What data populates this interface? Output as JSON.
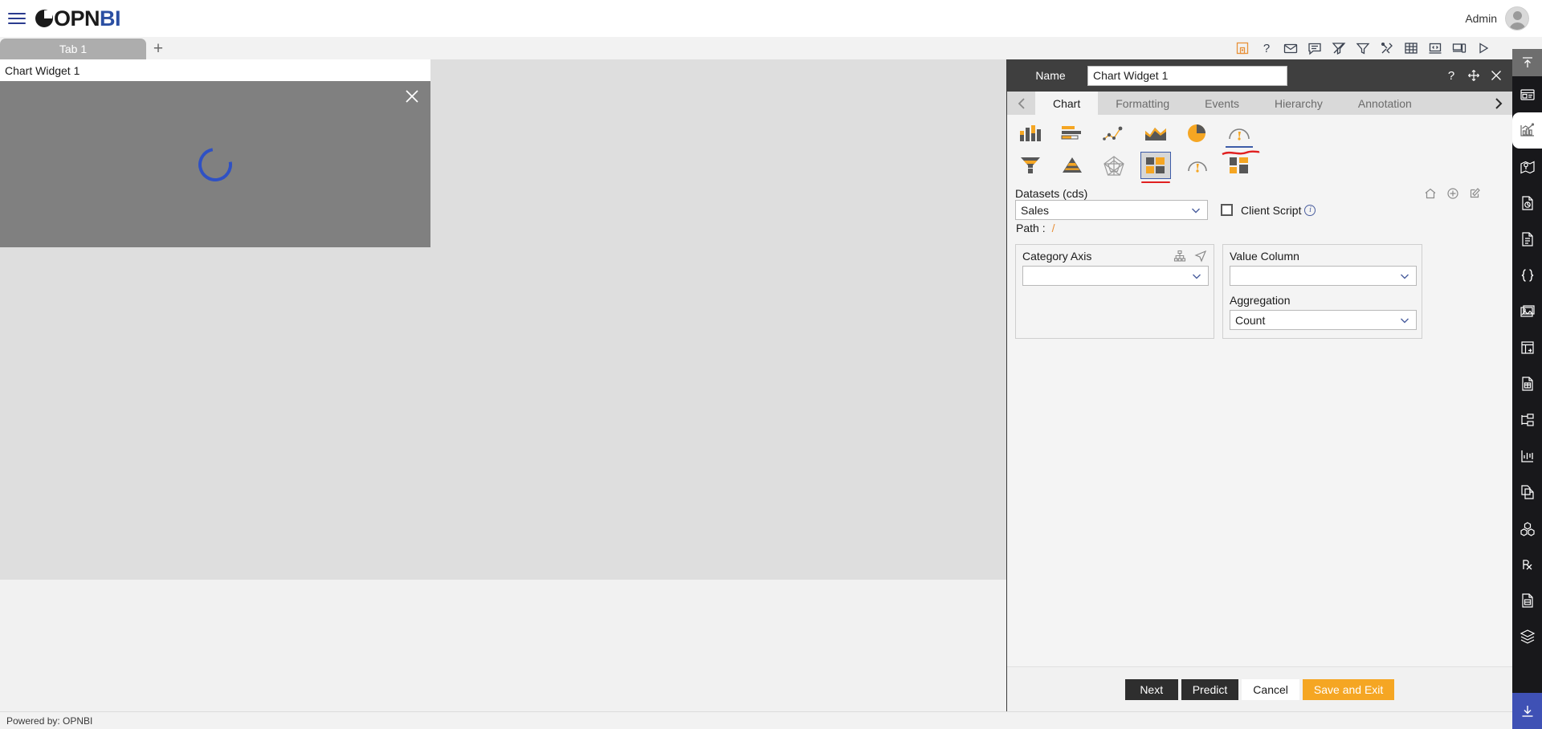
{
  "app": {
    "logo_text_op": "OPN",
    "logo_text_bi": "BI",
    "menu_icon": "hamburger-icon",
    "user_name": "Admin",
    "avatar_icon": "user-avatar-icon"
  },
  "tabstrip": {
    "tabs": [
      {
        "label": "Tab 1"
      }
    ],
    "add_label": "+",
    "toolbar_icons": [
      "save-icon",
      "help-icon",
      "mail-icon",
      "comment-icon",
      "clear-filter-icon",
      "filter-icon",
      "tools-icon",
      "table-icon",
      "code-view-icon",
      "device-preview-icon",
      "run-icon"
    ]
  },
  "canvas": {
    "widget": {
      "title": "Chart Widget 1",
      "close_icon": "close-icon",
      "loading_icon": "loading-spinner-icon"
    }
  },
  "footer": {
    "text": "Powered by: OPNBI"
  },
  "panel": {
    "name_label": "Name",
    "name_value": "Chart Widget 1",
    "name_placeholder": "Chart Widget 1",
    "title_actions": [
      "help-icon",
      "move-icon",
      "close-icon"
    ],
    "nav_prev_icon": "chevron-left-icon",
    "nav_next_icon": "chevron-right-icon",
    "tabs": [
      {
        "label": "Chart",
        "active": true
      },
      {
        "label": "Formatting",
        "active": false
      },
      {
        "label": "Events",
        "active": false
      },
      {
        "label": "Hierarchy",
        "active": false
      },
      {
        "label": "Annotation",
        "active": false
      }
    ],
    "chart_types_row1": [
      {
        "name": "column-chart-icon",
        "selected": false
      },
      {
        "name": "bar-chart-icon",
        "selected": false
      },
      {
        "name": "scatter-chart-icon",
        "selected": false
      },
      {
        "name": "area-chart-icon",
        "selected": false
      },
      {
        "name": "pie-chart-icon",
        "selected": false
      },
      {
        "name": "gauge-chart-icon",
        "selected": false
      }
    ],
    "chart_types_row2": [
      {
        "name": "funnel-chart-icon",
        "selected": false
      },
      {
        "name": "pyramid-chart-icon",
        "selected": false
      },
      {
        "name": "radar-chart-icon",
        "selected": false
      },
      {
        "name": "treemap-chart-icon",
        "selected": true
      },
      {
        "name": "speedometer-chart-icon",
        "selected": false
      },
      {
        "name": "tile-chart-icon",
        "selected": false
      }
    ],
    "datasets": {
      "label": "Datasets (cds)",
      "actions": [
        "home-icon",
        "add-icon",
        "edit-icon"
      ],
      "value": "Sales",
      "path_label": "Path :",
      "path_value": "/"
    },
    "client_script": {
      "label": "Client Script",
      "checked": false,
      "info_icon": "info-icon"
    },
    "category_axis": {
      "label": "Category Axis",
      "value": "",
      "icons": [
        "hierarchy-icon",
        "send-icon"
      ]
    },
    "value_column": {
      "label": "Value Column",
      "value": ""
    },
    "aggregation": {
      "label": "Aggregation",
      "value": "Count"
    },
    "buttons": [
      {
        "label": "Next",
        "style": "dark"
      },
      {
        "label": "Predict",
        "style": "dark"
      },
      {
        "label": "Cancel",
        "style": "light"
      },
      {
        "label": "Save and Exit",
        "style": "accent"
      }
    ]
  },
  "rail": {
    "top_icon": "collapse-up-icon",
    "items": [
      {
        "name": "widget-panel-icon",
        "active": false
      },
      {
        "name": "chart-widget-icon",
        "active": true
      },
      {
        "name": "map-widget-icon",
        "active": false
      },
      {
        "name": "report-widget-icon",
        "active": false
      },
      {
        "name": "document-widget-icon",
        "active": false
      },
      {
        "name": "code-widget-icon",
        "active": false
      },
      {
        "name": "image-widget-icon",
        "active": false
      },
      {
        "name": "frame-widget-icon",
        "active": false
      },
      {
        "name": "grid-widget-icon",
        "active": false
      },
      {
        "name": "tree-widget-icon",
        "active": false
      },
      {
        "name": "sparkline-widget-icon",
        "active": false
      },
      {
        "name": "copy-widget-icon",
        "active": false
      },
      {
        "name": "cube-widget-icon",
        "active": false
      },
      {
        "name": "prescription-widget-icon",
        "active": false
      },
      {
        "name": "form-widget-icon",
        "active": false
      },
      {
        "name": "layers-widget-icon",
        "active": false
      }
    ],
    "download_icon": "download-icon",
    "accent_color": "#3f51b5"
  },
  "colors": {
    "accent_orange": "#f5a623",
    "dark_gray": "#3f3f3f",
    "brand_blue": "#2b4fa2"
  }
}
